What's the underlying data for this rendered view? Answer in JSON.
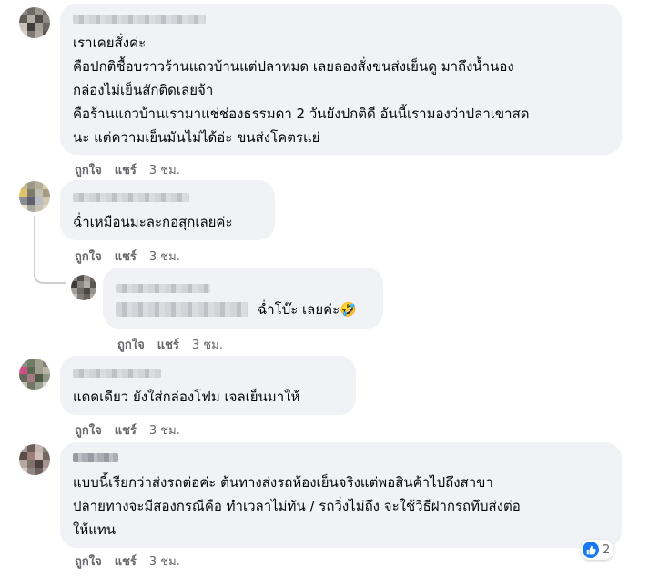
{
  "comments": [
    {
      "lines": [
        "เราเคยสั่งค่ะ",
        "คือปกติซื้อบราวร้านแถวบ้านแต่ปลาหมด เลยลองสั่งขนส่งเย็นดู มาถึงน้ำนอง",
        "กล่องไม่เย็นสักติดเลยจ้า",
        "คือร้านแถวบ้านเรามาแช่ช่องธรรมดา 2 วันยังปกติดี อันนี้เรามองว่าปลาเขาสด",
        "นะ แต่ความเย็นมันไม่ได้อ่ะ ขนส่งโคตรแย่"
      ],
      "like": "ถูกใจ",
      "share": "แชร์",
      "time": "3 ชม."
    },
    {
      "lines": [
        "ฉ่ำเหมือนมะละกอสุกเลยค่ะ"
      ],
      "like": "ถูกใจ",
      "share": "แชร์",
      "time": "3 ชม."
    },
    {
      "lines": [
        "ฉ่ำโบ๊ะ เลยค่ะ🤣"
      ],
      "like": "ถูกใจ",
      "share": "แชร์",
      "time": "3 ชม."
    },
    {
      "lines": [
        "แดดเดียว ยังใส่กล่องโฟม เจลเย็นมาให้"
      ],
      "like": "ถูกใจ",
      "share": "แชร์",
      "time": "3 ชม."
    },
    {
      "lines": [
        "แบบนี้เรียกว่าส่งรถต่อค่ะ ต้นทางส่งรถห้องเย็นจริงแต่พอสินค้าไปถึงสาขา",
        "ปลายทางจะมีสองกรณีคือ ทำเวลาไม่ทัน / รถวิ่งไม่ถึง จะใช้วิธีฝากรถทึบส่งต่อ",
        "ให้แทน"
      ],
      "like": "ถูกใจ",
      "share": "แชร์",
      "time": "3 ชม.",
      "reaction_count": "2"
    }
  ],
  "icons": {
    "reaction": "like-icon"
  },
  "colors": {
    "bubble": "#f0f2f5",
    "meta": "#65676b",
    "like_blue": "#1877f2"
  }
}
